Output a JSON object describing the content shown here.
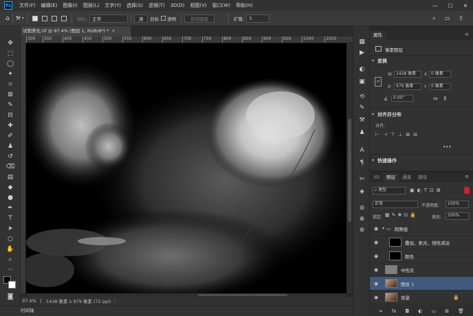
{
  "menubar": {
    "logo": "Ps",
    "items": [
      "文件(F)",
      "编辑(E)",
      "图像(I)",
      "图层(L)",
      "文字(Y)",
      "选择(S)",
      "滤镜(T)",
      "3D(D)",
      "视图(V)",
      "窗口(W)",
      "帮助(H)"
    ],
    "minimize": "—",
    "maximize": "☐",
    "close": "✕"
  },
  "options": {
    "feather_label": "羽化:",
    "blend_mode": "正常",
    "source_label": "源",
    "target_label": "目标",
    "transparent_label": "透明",
    "use_pattern": "使用图案",
    "spread_label": "扩散:",
    "spread_value": "5"
  },
  "document": {
    "tab_title": "试图美化.tif @ 97.4% (图层 1, RGB/8*) *",
    "ruler_marks": [
      "300",
      "350",
      "400",
      "450",
      "500",
      "550",
      "600",
      "650",
      "700",
      "750",
      "800",
      "850",
      "900",
      "950",
      "1000",
      "1050"
    ]
  },
  "status": {
    "zoom": "97.4%",
    "dims": "1438 像素 x 979 像素 (72 ppi)"
  },
  "timeline": {
    "label": "时间轴"
  },
  "properties": {
    "tab_label": "属性",
    "pixel_layer": "像素图层",
    "transform_header": "变换",
    "w_label": "W",
    "w_value": "1438 像素",
    "x_label": "X",
    "x_value": "0 像素",
    "h_label": "H",
    "h_value": "979 像素",
    "y_label": "Y",
    "y_value": "0 像素",
    "angle_value": "0.00°",
    "align_header": "对齐并分布",
    "align_label": "对齐:",
    "quick_actions": "快速操作"
  },
  "layers_panel": {
    "tabs": [
      "3D",
      "图层",
      "通道",
      "路径"
    ],
    "filter_kind": "类型",
    "blend_mode": "正常",
    "opacity_label": "不透明度:",
    "opacity_value": "100%",
    "lock_label": "锁定:",
    "fill_label": "填充:",
    "fill_value": "100%",
    "layers": [
      {
        "name": "观察组",
        "type": "group"
      },
      {
        "name": "叠加、柔光、线性减淡",
        "type": "black"
      },
      {
        "name": "颜色",
        "type": "black"
      },
      {
        "name": "中性灰",
        "type": "gray"
      },
      {
        "name": "图层 1",
        "type": "photo",
        "selected": true
      },
      {
        "name": "背景",
        "type": "photo",
        "locked": true
      }
    ]
  }
}
